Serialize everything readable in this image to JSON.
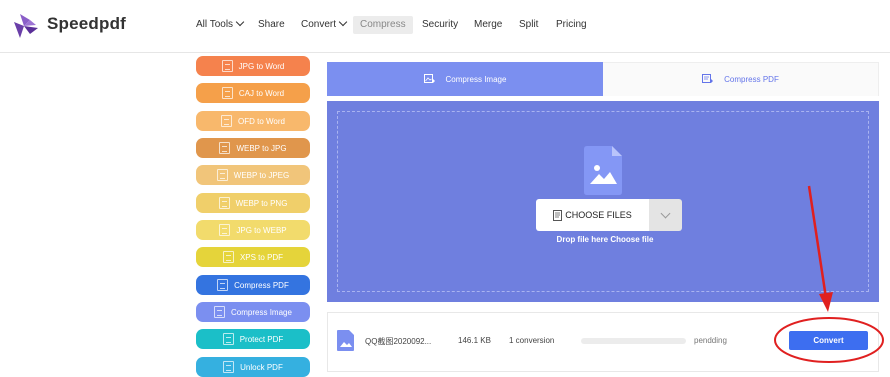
{
  "brand": {
    "name": "Speedpdf",
    "logo_icon": "speedpdf-logo-icon",
    "logo_color": "#6a3fa8"
  },
  "nav": {
    "items": [
      {
        "label": "All Tools",
        "has_dropdown": true,
        "active": false
      },
      {
        "label": "Share",
        "has_dropdown": false,
        "active": false
      },
      {
        "label": "Convert",
        "has_dropdown": true,
        "active": false
      },
      {
        "label": "Compress",
        "has_dropdown": false,
        "active": true
      },
      {
        "label": "Security",
        "has_dropdown": false,
        "active": false
      },
      {
        "label": "Merge",
        "has_dropdown": false,
        "active": false
      },
      {
        "label": "Split",
        "has_dropdown": false,
        "active": false
      },
      {
        "label": "Pricing",
        "has_dropdown": false,
        "active": false
      }
    ]
  },
  "sidebar": {
    "tools": [
      {
        "label": "JPG to Word",
        "color": "#f5824d"
      },
      {
        "label": "CAJ to Word",
        "color": "#f5a04a"
      },
      {
        "label": "OFD to Word",
        "color": "#f8b86c"
      },
      {
        "label": "WEBP to JPG",
        "color": "#e0964c"
      },
      {
        "label": "WEBP to JPEG",
        "color": "#f1c57a"
      },
      {
        "label": "WEBP to PNG",
        "color": "#f0cf6a"
      },
      {
        "label": "JPG to WEBP",
        "color": "#f2db6c"
      },
      {
        "label": "XPS to PDF",
        "color": "#e5d43a"
      },
      {
        "label": "Compress PDF",
        "color": "#3474e0"
      },
      {
        "label": "Compress Image",
        "color": "#7b8ff0"
      },
      {
        "label": "Protect PDF",
        "color": "#1bbfc8"
      },
      {
        "label": "Unlock PDF",
        "color": "#35b0e0"
      }
    ]
  },
  "tabs": [
    {
      "label": "Compress Image",
      "active": true,
      "icon": "image-compress-icon"
    },
    {
      "label": "Compress PDF",
      "active": false,
      "icon": "pdf-compress-icon"
    }
  ],
  "upload": {
    "choose_label": "CHOOSE FILES",
    "drop_text": "Drop file here Choose file",
    "file_icon": "image-file-icon",
    "background": "#6f7fdf"
  },
  "file_row": {
    "name": "QQ截图2020092...",
    "size": "146.1 KB",
    "conversions": "1 conversion",
    "status": "pendding",
    "progress": 0,
    "button_label": "Convert",
    "icon": "image-file-icon"
  },
  "colors": {
    "accent": "#3d6ef0",
    "annotation": "#e02020",
    "tab_active": "#7b8ff0"
  }
}
